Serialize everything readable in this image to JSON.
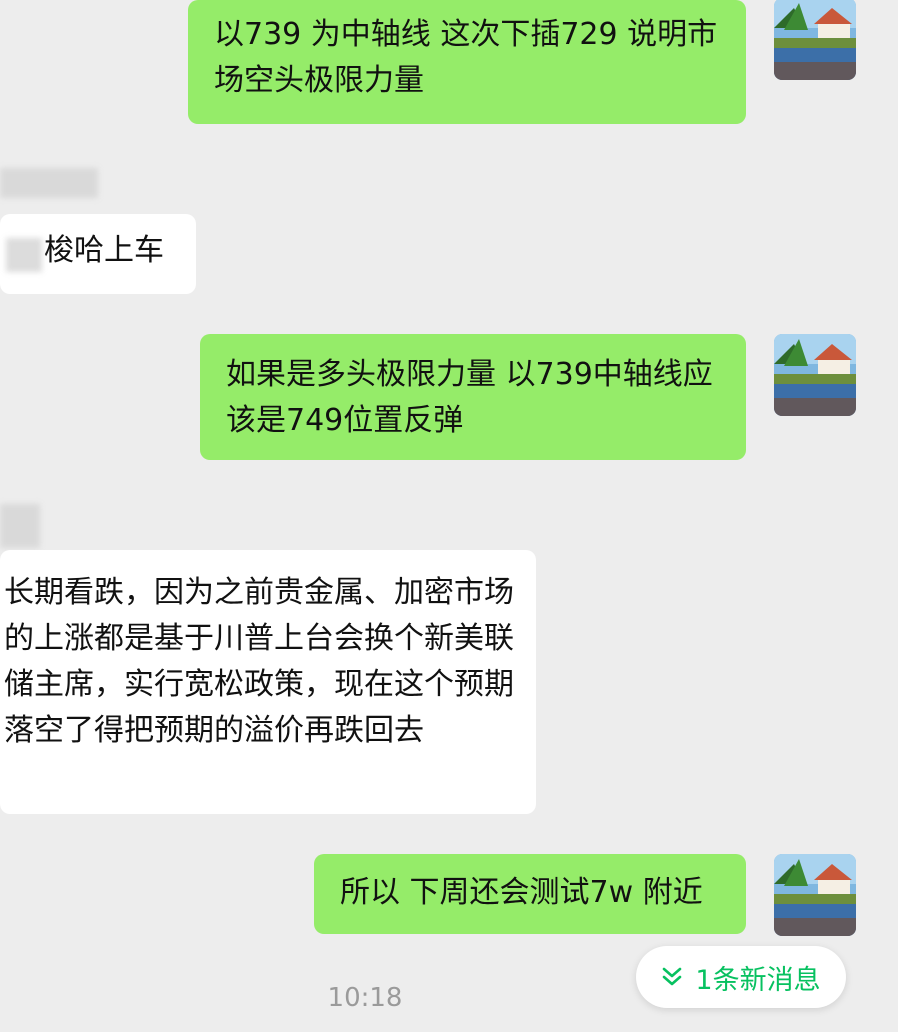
{
  "theme": {
    "background": "#ededed",
    "outgoing_bubble": "#95ec69",
    "incoming_bubble": "#ffffff",
    "accent": "#07c160"
  },
  "messages": [
    {
      "direction": "outgoing",
      "text": "以739 为中轴线  这次下插729 说明市场空头极限力量"
    },
    {
      "direction": "incoming",
      "text": "梭哈上车"
    },
    {
      "direction": "outgoing",
      "text": "如果是多头极限力量  以739中轴线应该是749位置反弹"
    },
    {
      "direction": "incoming",
      "text": "长期看跌，因为之前贵金属、加密市场的上涨都是基于川普上台会换个新美联储主席，实行宽松政策，现在这个预期落空了得把预期的溢价再跌回去"
    },
    {
      "direction": "outgoing",
      "text": "所以 下周还会测试7w 附近"
    }
  ],
  "timestamp": "10:18",
  "new_message_pill": {
    "label": "1条新消息",
    "icon": "double-chevron-down-icon"
  },
  "avatar_icon": "resort-pool-avatar"
}
